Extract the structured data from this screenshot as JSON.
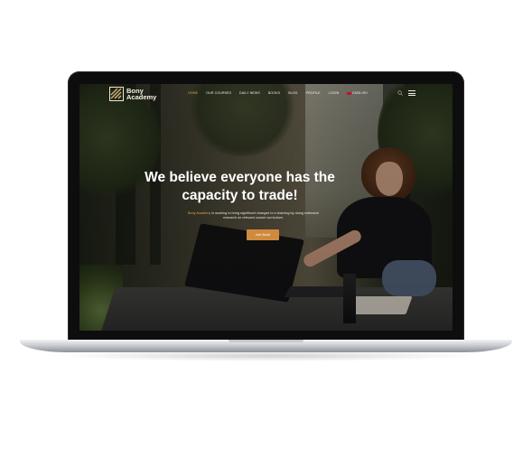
{
  "site": {
    "logo_line1": "Bony",
    "logo_line2": "Academy",
    "logo_icon": "book-stripes-logo"
  },
  "nav": {
    "items": [
      {
        "label": "Home",
        "active": true
      },
      {
        "label": "Our Courses"
      },
      {
        "label": "Daily News"
      },
      {
        "label": "Books"
      },
      {
        "label": "Blog"
      },
      {
        "label": "Profile"
      },
      {
        "label": "Login"
      },
      {
        "label": "English",
        "icon": "uk-flag-icon"
      }
    ],
    "search_icon": "search-icon",
    "menu_icon": "hamburger-icon"
  },
  "hero": {
    "title": "We believe everyone has the capacity to trade!",
    "subtitle_brand": "Bony Academy",
    "subtitle_rest": " is working to bring significant changes to e-learning by doing extensive research on relevant course curriculum.",
    "cta_label": "Join Now!"
  },
  "colors": {
    "accent": "#d08a3e",
    "active_nav": "#d9a25a",
    "text_light": "#ffffff"
  }
}
